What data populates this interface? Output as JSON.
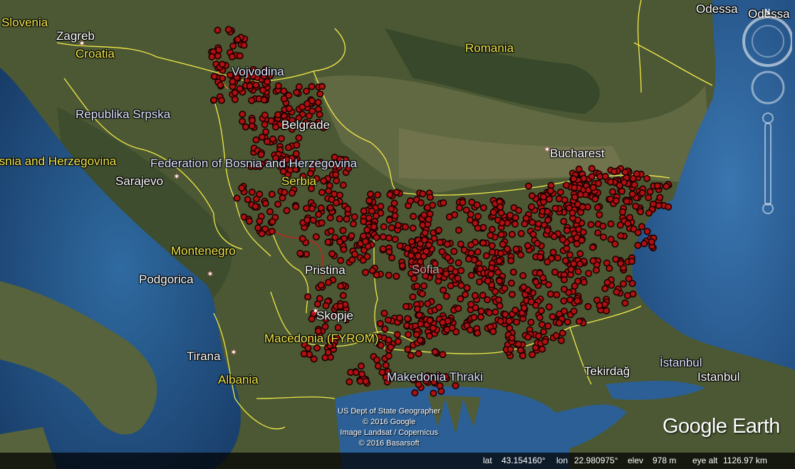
{
  "map": {
    "regions": [
      {
        "name": "Slovenia"
      },
      {
        "name": "Croatia"
      },
      {
        "name": "Vojvodina"
      },
      {
        "name": "Romania"
      },
      {
        "name": "Republika Srpska"
      },
      {
        "name": "Bosnia and Herzegovina"
      },
      {
        "name": "Federation of Bosnia and Herzegovina"
      },
      {
        "name": "Serbia"
      },
      {
        "name": "Montenegro"
      },
      {
        "name": "Macedonia (FYROM)"
      },
      {
        "name": "Albania"
      },
      {
        "name": "Makedonia Thraki"
      }
    ],
    "cities": [
      {
        "name": "Zagreb"
      },
      {
        "name": "Belgrade"
      },
      {
        "name": "Bucharest"
      },
      {
        "name": "Sarajevo"
      },
      {
        "name": "Podgorica"
      },
      {
        "name": "Pristina"
      },
      {
        "name": "Sofia"
      },
      {
        "name": "Skopje"
      },
      {
        "name": "Tirana"
      },
      {
        "name": "Tekirdağ"
      },
      {
        "name": "İstanbul"
      },
      {
        "name": "Istanbul"
      },
      {
        "name": "Odessa"
      },
      {
        "name": "Odessa"
      }
    ]
  },
  "credits": {
    "line1": "US Dept of State Geographer",
    "line2": "© 2016 Google",
    "line3": "Image Landsat / Copernicus",
    "line4": "© 2016 Basarsoft"
  },
  "logo": "Google Earth",
  "status": {
    "lat_label": "lat",
    "lat_value": "43.154160°",
    "lon_label": "lon",
    "lon_value": "22.980975°",
    "elev_label": "elev",
    "elev_value": "978 m",
    "eye_label": "eye alt",
    "eye_value": "1126.97 km"
  },
  "colors": {
    "sea": "#2a5a8c",
    "land": "#4d5a38",
    "border": "#f2e84b",
    "marker": "#b01010"
  },
  "compass_icon": "compass-icon",
  "look_icon": "look-joystick-icon",
  "zoom_icon": "zoom-slider-icon"
}
